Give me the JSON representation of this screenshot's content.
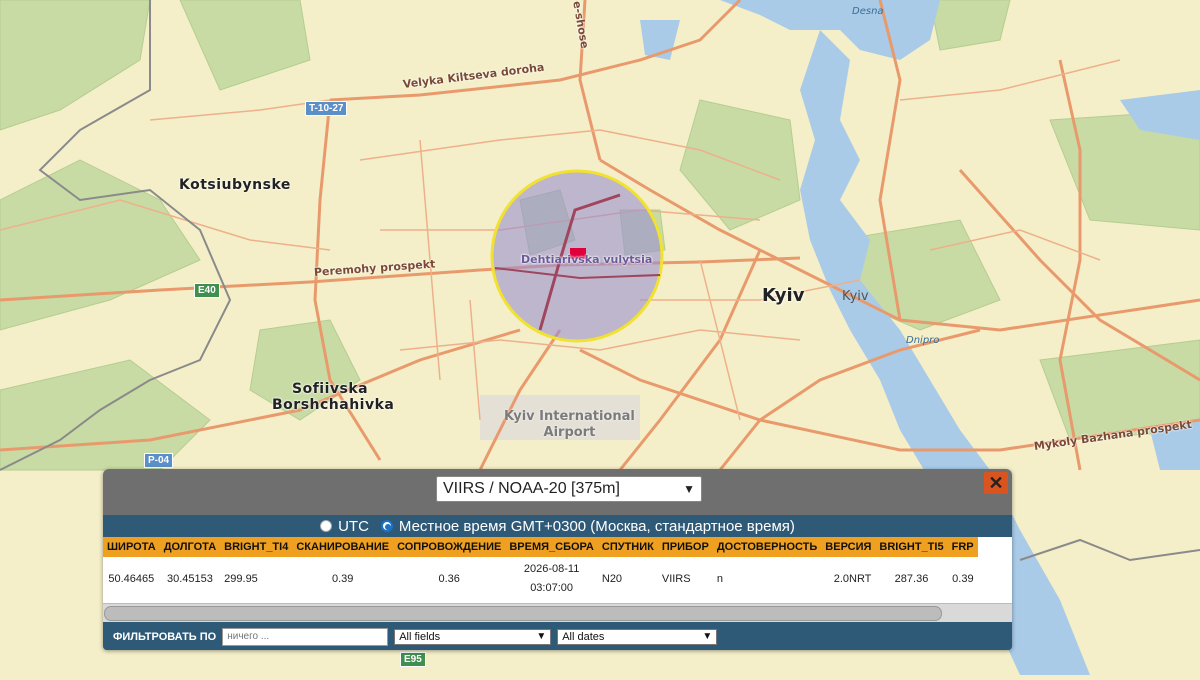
{
  "map": {
    "labels": {
      "kotsiubynske": "Kotsiubynske",
      "sofiivska": "Sofiivska",
      "borshchahivka": "Borshchahivka",
      "kyiv": "Kyiv",
      "kyiv_small": "Kyiv",
      "airport_line1": "Kyiv International",
      "airport_line2": "Airport",
      "velyka": "Velyka Kiltseva doroha",
      "peremohy": "Peremohy prospekt",
      "dehtiarivska": "Dehtiarivska vulytsia",
      "bazhana": "Mykoly Bazhana prospekt",
      "shose": "e-shose",
      "desna": "Desna",
      "dnipro": "Dnipro",
      "t1027": "T-10-27",
      "e40": "E40",
      "p04": "P-04",
      "e95": "E95"
    },
    "colors": {
      "land": "#f4efc8",
      "park": "#c8dba5",
      "water": "#a9cbe8",
      "road": "#e99a6c",
      "highlight_circle": "#9a8fd0",
      "circle_border": "#f1e130",
      "marker": "#e0003c"
    }
  },
  "panel": {
    "source_select": "VIIRS / NOAA-20 [375m]",
    "close_label": "✕",
    "timezone": {
      "utc_label": "UTC",
      "local_label": "Местное время GMT+0300 (Москва, стандартное время)",
      "selected": "local"
    },
    "table": {
      "headers": [
        "ШИРОТА",
        "ДОЛГОТА",
        "BRIGHT_TI4",
        "СКАНИРОВАНИЕ",
        "СОПРОВОЖДЕНИЕ",
        "ВРЕМЯ_СБОРА",
        "СПУТНИК",
        "ПРИБОР",
        "ДОСТОВЕРНОСТЬ",
        "ВЕРСИЯ",
        "BRIGHT_TI5",
        "FRP"
      ],
      "rows": [
        {
          "lat": "50.46465",
          "lon": "30.45153",
          "ti4": "299.95",
          "scan": "0.39",
          "track": "0.36",
          "date": "2026-08-11",
          "time": "03:07:00",
          "sat": "N20",
          "instrument": "VIIRS",
          "confidence": "n",
          "version": "2.0NRT",
          "ti5": "287.36",
          "frp": "0.39"
        }
      ]
    },
    "filter": {
      "label": "ФИЛЬТРОВАТЬ ПО",
      "placeholder": "ничего ...",
      "fields": "All fields",
      "dates": "All dates"
    }
  }
}
